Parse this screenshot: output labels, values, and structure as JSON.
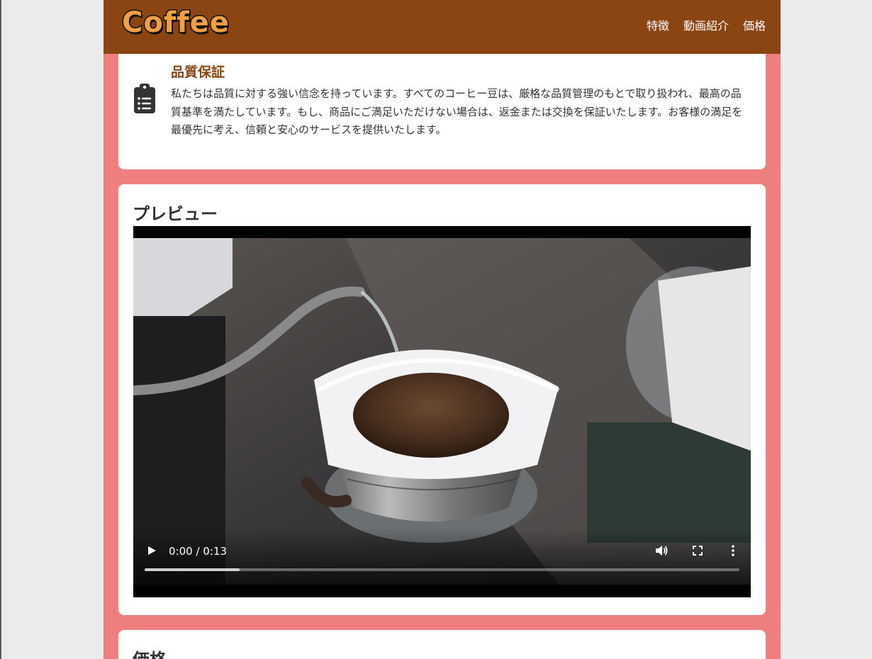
{
  "header": {
    "logo": "Coffee",
    "nav": [
      "特徴",
      "動画紹介",
      "価格"
    ]
  },
  "quality": {
    "title": "品質保証",
    "text": "私たちは品質に対する強い信念を持っています。すべてのコーヒー豆は、厳格な品質管理のもとで取り扱われ、最高の品質基準を満たしています。もし、商品にご満足いただけない場合は、返金または交換を保証いたします。お客様の満足を最優先に考え、信頼と安心のサービスを提供いたします。",
    "icon": "clipboard-list-icon"
  },
  "preview": {
    "title": "プレビュー",
    "video": {
      "time": "0:00 / 0:13",
      "progress_fraction": 0.16
    }
  },
  "price": {
    "title": "価格"
  },
  "colors": {
    "header_bg": "#8b4513",
    "page_bg": "#ef7f7f",
    "accent": "#8b4513",
    "logo": "#f0a040"
  }
}
